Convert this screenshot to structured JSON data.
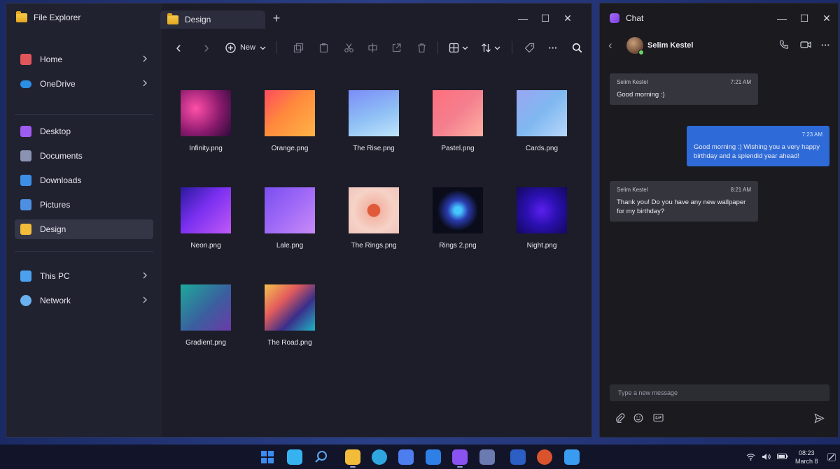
{
  "explorer": {
    "title": "File Explorer",
    "tab_label": "Design",
    "tab_add": "+",
    "window_controls": {
      "minimize": "—",
      "maximize": "☐",
      "close": "✕"
    },
    "sidebar": [
      {
        "label": "Home",
        "icon": "home-icon",
        "color": "#e0565b",
        "chevron": true
      },
      {
        "label": "OneDrive",
        "icon": "cloud-icon",
        "color": "#2b8de3",
        "chevron": true
      },
      {
        "label": "Desktop",
        "icon": "desktop-icon",
        "color": "#9e5cf0",
        "chevron": false
      },
      {
        "label": "Documents",
        "icon": "document-icon",
        "color": "#8a93b2",
        "chevron": false
      },
      {
        "label": "Downloads",
        "icon": "download-icon",
        "color": "#3d8fe6",
        "chevron": false
      },
      {
        "label": "Pictures",
        "icon": "picture-icon",
        "color": "#4d8fe0",
        "chevron": false
      },
      {
        "label": "Design",
        "icon": "folder-icon",
        "color": "#f2bb3a",
        "chevron": false,
        "active": true
      },
      {
        "label": "This PC",
        "icon": "computer-icon",
        "color": "#4ba0ef",
        "chevron": true
      },
      {
        "label": "Network",
        "icon": "network-icon",
        "color": "#6bb0ef",
        "chevron": true
      }
    ],
    "toolbar": {
      "back": "‹",
      "forward": "›",
      "new_label": "New",
      "more": "···"
    },
    "files": [
      {
        "name": "Infinity.png",
        "bg": "radial-gradient(circle at 30% 40%, #ff4fa8, #8a1a6d 55%, #2a0b3a)"
      },
      {
        "name": "Orange.png",
        "bg": "linear-gradient(135deg, #ff4c5e 0%, #ff8a3c 45%, #ffb347 100%)"
      },
      {
        "name": "The Rise.png",
        "bg": "linear-gradient(160deg, #7b8cf7 0%, #8fc0f5 55%, #bfe5fb 100%)"
      },
      {
        "name": "Pastel.png",
        "bg": "linear-gradient(135deg, #ff6f7d 0%, #f47f8e 50%, #ffb1a2 100%)"
      },
      {
        "name": "Cards.png",
        "bg": "linear-gradient(135deg, #9aa6f3 0%, #7fb8f0 50%, #b9d7fb 100%)"
      },
      {
        "name": "Neon.png",
        "bg": "linear-gradient(135deg, #2a1a9e 0%, #7a2ff0 45%, #c05af7 100%)"
      },
      {
        "name": "Lale.png",
        "bg": "linear-gradient(135deg, #7a4ef0 0%, #a06af7 50%, #c98bf7 100%)"
      },
      {
        "name": "The Rings.png",
        "bg": "radial-gradient(circle at 50% 50%, #e05a3a 18%, #f2b6a5 20%, #f6d2c7 60%, #f0c5bb 100%)"
      },
      {
        "name": "Rings 2.png",
        "bg": "radial-gradient(circle at 50% 50%, #46c6ff 10%, #2a3cb0 30%, #0a0c1a 60%)"
      },
      {
        "name": "Night.png",
        "bg": "radial-gradient(circle at 50% 50%, #5b1ff0 0%, #2b10b0 45%, #12085e 100%)"
      },
      {
        "name": "Gradient.png",
        "bg": "linear-gradient(135deg, #1ea99b 0%, #3a5f9e 55%, #6a3aa8 100%)"
      },
      {
        "name": "The Road.png",
        "bg": "linear-gradient(135deg, #f2c14e 0%, #e45c5c 35%, #3a2e8a 65%, #1fb4c4 100%)"
      }
    ]
  },
  "chat": {
    "title": "Chat",
    "contact": "Selim Kestel",
    "messages": [
      {
        "dir": "in",
        "sender": "Selim Kestel",
        "time": "7:21 AM",
        "text": "Good morning :)"
      },
      {
        "dir": "out",
        "sender": "",
        "time": "7:23 AM",
        "text": "Good morning :) Wishing you a very happy birthday and a splendid year ahead!"
      },
      {
        "dir": "in",
        "sender": "Selim Kestel",
        "time": "8:21 AM",
        "text": "Thank you! Do you have any new wallpaper for my birthday?"
      }
    ],
    "compose_placeholder": "Type a new message"
  },
  "taskbar": {
    "apps": [
      {
        "name": "start-icon",
        "color": "#3b8cf0"
      },
      {
        "name": "task-view-icon",
        "color": "#36b2f0"
      },
      {
        "name": "search-icon",
        "color": "#5aa8f2"
      },
      {
        "name": "file-explorer-icon",
        "color": "#f2bb3a"
      },
      {
        "name": "edge-icon",
        "color": "#2fa6e0"
      },
      {
        "name": "photos-icon",
        "color": "#4c7ef0"
      },
      {
        "name": "mail-icon",
        "color": "#2e7fe6"
      },
      {
        "name": "teams-chat-icon",
        "color": "#8a52f0"
      },
      {
        "name": "video-editor-icon",
        "color": "#6b7ab0"
      },
      {
        "name": "word-icon",
        "color": "#2b5fc4"
      },
      {
        "name": "powerpoint-icon",
        "color": "#d9542d"
      },
      {
        "name": "store-icon",
        "color": "#3a9cf0"
      }
    ],
    "time": "08:23",
    "date": "March 8"
  }
}
